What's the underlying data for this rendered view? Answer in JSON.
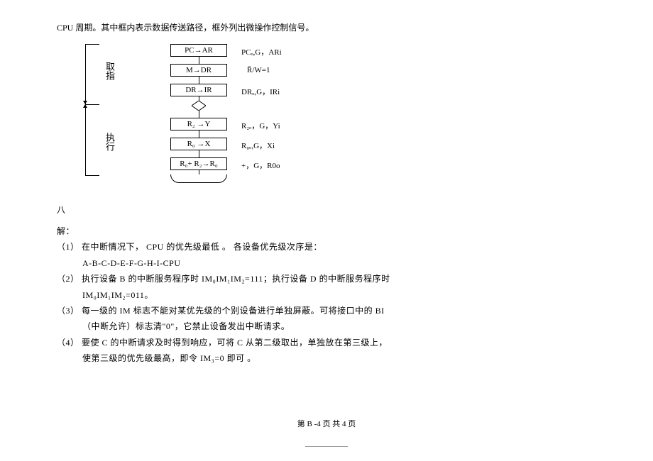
{
  "intro": "CPU 周期。其中框内表示数据传送路径，框外列出微操作控制信号。",
  "phases": {
    "fetch": "取指",
    "execute": "执行"
  },
  "boxes": {
    "b1": "PC→AR",
    "b2": "M→DR",
    "b3": "DR→IR",
    "b4": "R₂ →Y",
    "b5": "R₀ →X",
    "b6": "R₀+ R₂→R₀"
  },
  "annotations": {
    "a1": "PCₒ,G，ARi",
    "a2": "R̄/W=1",
    "a3": "DRₒ,G，IRi",
    "a4": "R₂ₒ，G，Yi",
    "a5": "R₀ₒ,G，Xi",
    "a6": "+，G，R0o"
  },
  "section_eight": "八",
  "answer_header": "解：",
  "answers": {
    "a1_l1": "（1） 在中断情况下， CPU 的优先级最低 。 各设备优先级次序是：",
    "a1_l2": "A-B-C-D-E-F-G-H-I-CPU",
    "a2_l1": "（2） 执行设备 B 的中断服务程序时 IM₀IM₁IM₂=111；执行设备 D 的中断服务程序时",
    "a2_l2": "IM₀IM₁IM₂=011。",
    "a3_l1": "（3） 每一级的 IM 标志不能对某优先级的个别设备进行单独屏蔽。可将接口中的 BI",
    "a3_l2": "（中断允许）标志清\"0\"，它禁止设备发出中断请求。",
    "a4_l1": "（4） 要使 C 的中断请求及时得到响应，可将 C 从第二级取出，单独放在第三级上，",
    "a4_l2": "使第三级的优先级最高，即令 IM₃=0 即可  。"
  },
  "footer": "第 B -4 页 共  4 页"
}
